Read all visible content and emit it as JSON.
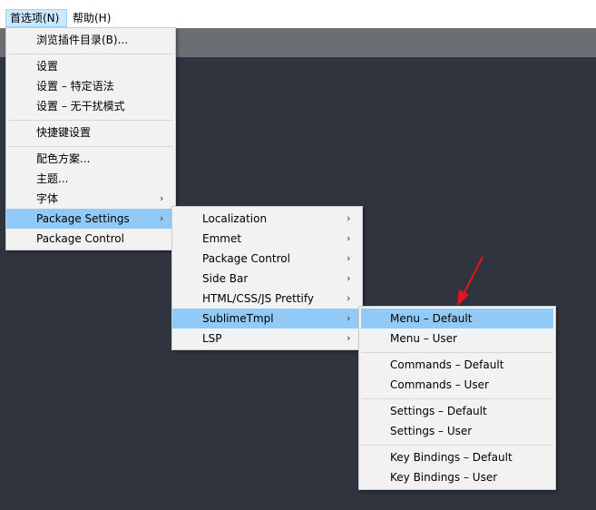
{
  "menubar": {
    "preferences_label": "首选项(N)",
    "help_label": "帮助(H)"
  },
  "prefs_menu": {
    "items": [
      {
        "label": "浏览插件目录(B)..."
      },
      {
        "label": "设置"
      },
      {
        "label": "设置 – 特定语法"
      },
      {
        "label": "设置 – 无干扰模式"
      },
      {
        "label": "快捷键设置"
      },
      {
        "label": "配色方案..."
      },
      {
        "label": "主题..."
      },
      {
        "label": "字体"
      },
      {
        "label": "Package Settings"
      },
      {
        "label": "Package Control"
      }
    ],
    "submenu_arrow": "›"
  },
  "package_settings_menu": {
    "items": [
      {
        "label": "Localization"
      },
      {
        "label": "Emmet"
      },
      {
        "label": "Package Control"
      },
      {
        "label": "Side Bar"
      },
      {
        "label": "HTML/CSS/JS Prettify"
      },
      {
        "label": "SublimeTmpl"
      },
      {
        "label": "LSP"
      }
    ],
    "submenu_arrow": "›"
  },
  "sublimetmpl_menu": {
    "items": [
      {
        "label": "Menu – Default"
      },
      {
        "label": "Menu – User"
      },
      {
        "label": "Commands – Default"
      },
      {
        "label": "Commands – User"
      },
      {
        "label": "Settings – Default"
      },
      {
        "label": "Settings – User"
      },
      {
        "label": "Key Bindings – Default"
      },
      {
        "label": "Key Bindings – User"
      }
    ]
  },
  "colors": {
    "highlight": "#91c9f7",
    "editor_bg": "#2f343f",
    "tabstrip_bg": "#6b6e73",
    "menu_bg": "#f2f2f2",
    "annotation_arrow": "#e8141b"
  }
}
